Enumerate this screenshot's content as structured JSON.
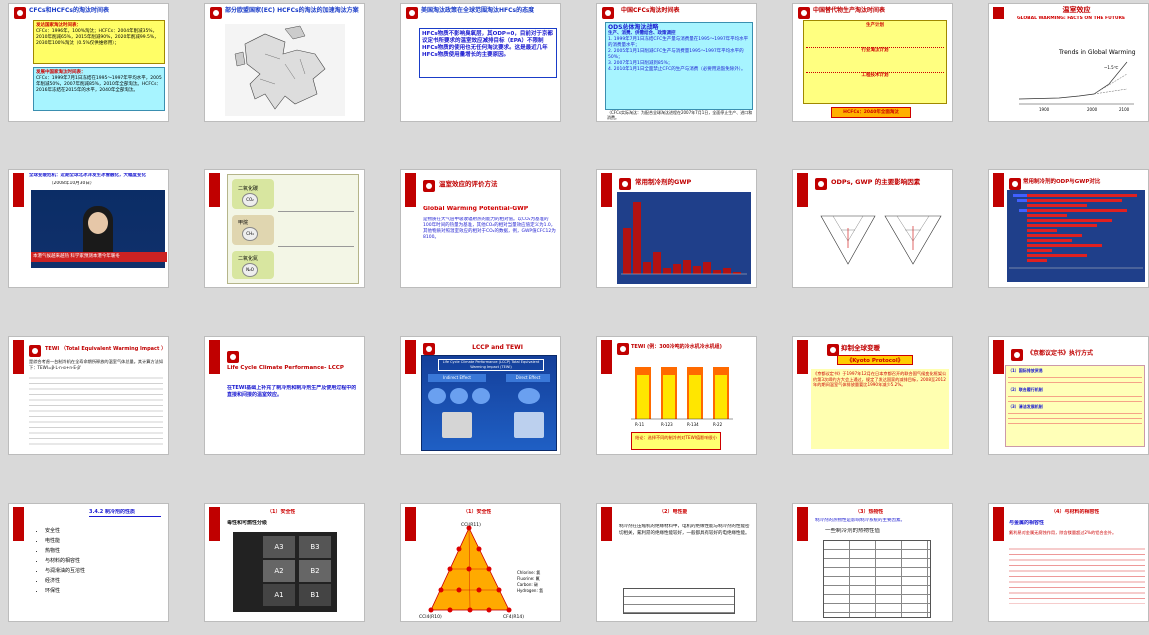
{
  "slides": [
    {
      "title": "CFCs和HCFCs的淘汰时间表",
      "box1_title": "发达国家淘汰时间表：",
      "box1_text": "CFCs：1996年，100%淘汰；HCFCs：2004年削减35%，2010年削减65%，2015年削减90%，2020年削减99.5%，2030年100%淘汰（0.5%仅供维修用）；",
      "box2_title": "发展中国家淘汰时间表：",
      "box2_text": "CFCs：1999年7月1日冻结在1995～1997年平均水平，2005年削减50%，2007年削减85%，2010年全部淘汰。HCFCs：2016年冻结在2015年的水平，2040年全部淘汰。"
    },
    {
      "title": "部分欧盟国家(EC) HCFCs的淘汰的加速淘汰方案"
    },
    {
      "title": "美国淘汰政策在全球范围淘汰HFCs的态度",
      "text": "HFCs物质不影响臭氧层，其ODP=0，目前对于京都议定书所要求的温室效应减排目标（EPA）不限制HFCs物质的使用也无任何淘汰要求。这是最近几年HFCs物质使用量增长的主要原因。"
    },
    {
      "title": "中国CFCs淘汰时间表",
      "sub": "ODS总体淘汰战略",
      "sub2": "生产、消费、供需结合、政策调控",
      "items": [
        "1. 1999年7月1日冻结CFC生产量与消费量在1995～1997年平均水平的消费量水平；",
        "2. 2005年1月1日削减CFC生产与消费量1995～1997年平均水平的50%；",
        "3. 2007年1月1日削减到85%；",
        "4. 2010年1月1日全面禁止CFC的生产与消费（必要用途豁免除外）。"
      ],
      "foot": "（CFCs实际淘汰：为配合全球淘汰进程在2007年7月1日，全面停止生产、进口和消费。"
    },
    {
      "title": "中国替代物生产淘汰时间表",
      "s1": "生产计划",
      "s2": "行业淘汰计划",
      "s3": "工程技术计划",
      "foot": "HCFCs：2040年全面淘汰"
    },
    {
      "title": "温室效应",
      "sub": "GLOBAL WARMING: FACTS ON THE FUTURE",
      "chart_label": "Trends in Global Warming",
      "tick1": "1900",
      "tick2": "2000",
      "tick3": "2100",
      "annot": "~1.5℃"
    },
    {
      "title": "全球变暖危机：近期全球北冰洋发生冰雪融化，大幅度变化",
      "date": "（2008年10月30日）",
      "caption": "本港气候越来越热 科学家预测本港今年暖冬"
    },
    {
      "title": "二氧化碳 / 甲烷 / 二氧化氮",
      "r1": "二氧化碳",
      "r2": "甲烷",
      "r3": "二氧化氮"
    },
    {
      "title": "温室效应的评价方法",
      "sub": "Global Warming Potential-GWP",
      "text": "是物质在大气层中吸收辐射热的能力的相对值。以CO₂为基准的100年时间的热量为基准，其他CO₂的相对当量效应值定义为1.0，其他物质对照温室效应的相对于CO₂的数据，例，GWP值CFC12为8100。"
    },
    {
      "title": "常用制冷剂的GWP"
    },
    {
      "title": "ODPs, GWP 的主要影响因素"
    },
    {
      "title": "常用制冷剂的ODP与GWP对比"
    },
    {
      "title": "TEWI （Total Equivalent Warming Impact ）",
      "text": "是综合考虑一台制冷机在全寿命期所释放的温室气体总量。其计算方法如下：TEWI=β·L·n·α+n·E·β'"
    },
    {
      "title": "Life Cycle Climate Performance- LCCP",
      "text": "在TEWI基础上补充了制冷剂和制冷剂生产及使用过程中的直接和间接的温室效应。"
    },
    {
      "title": "LCCP and TEWI",
      "inner": "Life Cycle Climate Performance (LCCP) Total Equivalent Warming Impact (TEWI)",
      "left": "Indirect Effect",
      "right": "Direct Effect"
    },
    {
      "title": "TEWI (例：300冷吨的冷水机冷水机组)",
      "cats": [
        "R-11",
        "R-123",
        "R-134",
        "R-22"
      ],
      "foot": "结论：选择不同的制冷剂对TEWI值影响很小"
    },
    {
      "title": "抑制全球变暖",
      "sub": "《Kyoto Protocol》",
      "text": "《京都议定书》于1997年12月在日本京都召开的联合国气候变化框架公约第3次缔约方大会上通过，规定了发达国家的减排目标，2008至2012年的期间温室气体排放量要比1990年减少5.2%。"
    },
    {
      "title": "《京都议定书》执行方式",
      "s1": "（1）国际排放贸易",
      "s2": "（2）联合履行机制",
      "s3": "（3）清洁发展机制"
    },
    {
      "title": "3.4.2 制冷剂的性质",
      "items": [
        "安全性",
        "电性能",
        "热物性",
        "与材料的相容性",
        "与润滑油的互溶性",
        "经济性",
        "环保性"
      ]
    },
    {
      "title": "（1）安全性",
      "sub": "毒性和可燃性分级",
      "cells": [
        "A3",
        "B3",
        "A2",
        "B2",
        "A1",
        "B1"
      ]
    },
    {
      "title": "（1）安全性",
      "top": "CCl(R11)",
      "left": "CCl4(R10)",
      "right": "CF4(R14)",
      "legend": [
        "Chlorine: 氯",
        "Fluorine: 氟",
        "Carbon: 碳",
        "Hydrogen: 氢"
      ]
    },
    {
      "title": "（2）电性能",
      "text": "制冷剂在压缩机的绝缘材料中，电机的绝缘性能与制冷剂的性能密切相关，氟利昂的绝缘性能较好，一般都具有较好的电绝缘性能。"
    },
    {
      "title": "（3）热物性",
      "text": "制冷剂的热物性是影响制冷系统的主要因素。",
      "sub": "一些制冷剂的热物性值"
    },
    {
      "title": "（4）与材料的相容性",
      "sub": "与金属的相容性",
      "text": "氟利昂对金属无腐蚀作用，除含镁量超过2%的铝合金外。"
    }
  ]
}
